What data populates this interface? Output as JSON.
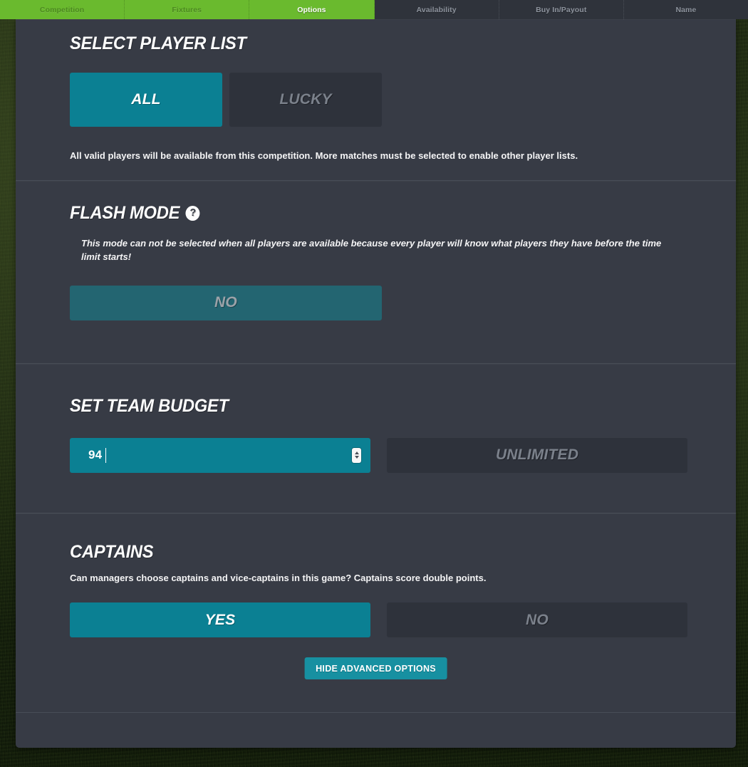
{
  "colors": {
    "accent_teal": "#0b8093",
    "accent_teal_dim": "#236571",
    "panel_bg": "#373b45",
    "button_off_bg": "#2e323b",
    "tab_green": "#6aba2e",
    "button_footer": "#1790a1",
    "text_white": "#ffffff",
    "text_muted": "#7b818b"
  },
  "tabs": [
    {
      "label": "Competition",
      "state": "complete",
      "active": false
    },
    {
      "label": "Fixtures",
      "state": "complete",
      "active": false
    },
    {
      "label": "Options",
      "state": "complete",
      "active": true
    },
    {
      "label": "Availability",
      "state": "pending",
      "active": false
    },
    {
      "label": "Buy In/Payout",
      "state": "pending",
      "active": false
    },
    {
      "label": "Name",
      "state": "pending",
      "active": false
    }
  ],
  "sections": {
    "player_list": {
      "heading": "Select Player List",
      "options": [
        {
          "label": "All",
          "selected": true
        },
        {
          "label": "Lucky",
          "selected": false
        }
      ],
      "note": "All valid players will be available from this competition. More matches must be selected to enable other player lists."
    },
    "flash_mode": {
      "heading": "Flash Mode",
      "help_icon": "question-mark-circle-icon",
      "help_icon_glyph": "?",
      "note": "This mode can not be selected when all players are available because every player will know what players they have before the time limit starts!",
      "options": [
        {
          "label": "No",
          "selected": true,
          "disabled": true
        }
      ]
    },
    "team_budget": {
      "heading": "Set Team Budget",
      "input": {
        "value": "94",
        "placeholder": "Enter budget",
        "focused": true,
        "spinner_up_icon": "chevron-up-icon",
        "spinner_down_icon": "chevron-down-icon"
      },
      "options": [
        {
          "label": "Unlimited",
          "selected": false
        }
      ]
    },
    "captains": {
      "heading": "Captains",
      "note": "Can managers choose captains and vice-captains in this game? Captains score double points.",
      "options": [
        {
          "label": "Yes",
          "selected": true
        },
        {
          "label": "No",
          "selected": false
        }
      ]
    }
  },
  "footer": {
    "toggle_advanced_label": "Hide Advanced Options"
  }
}
